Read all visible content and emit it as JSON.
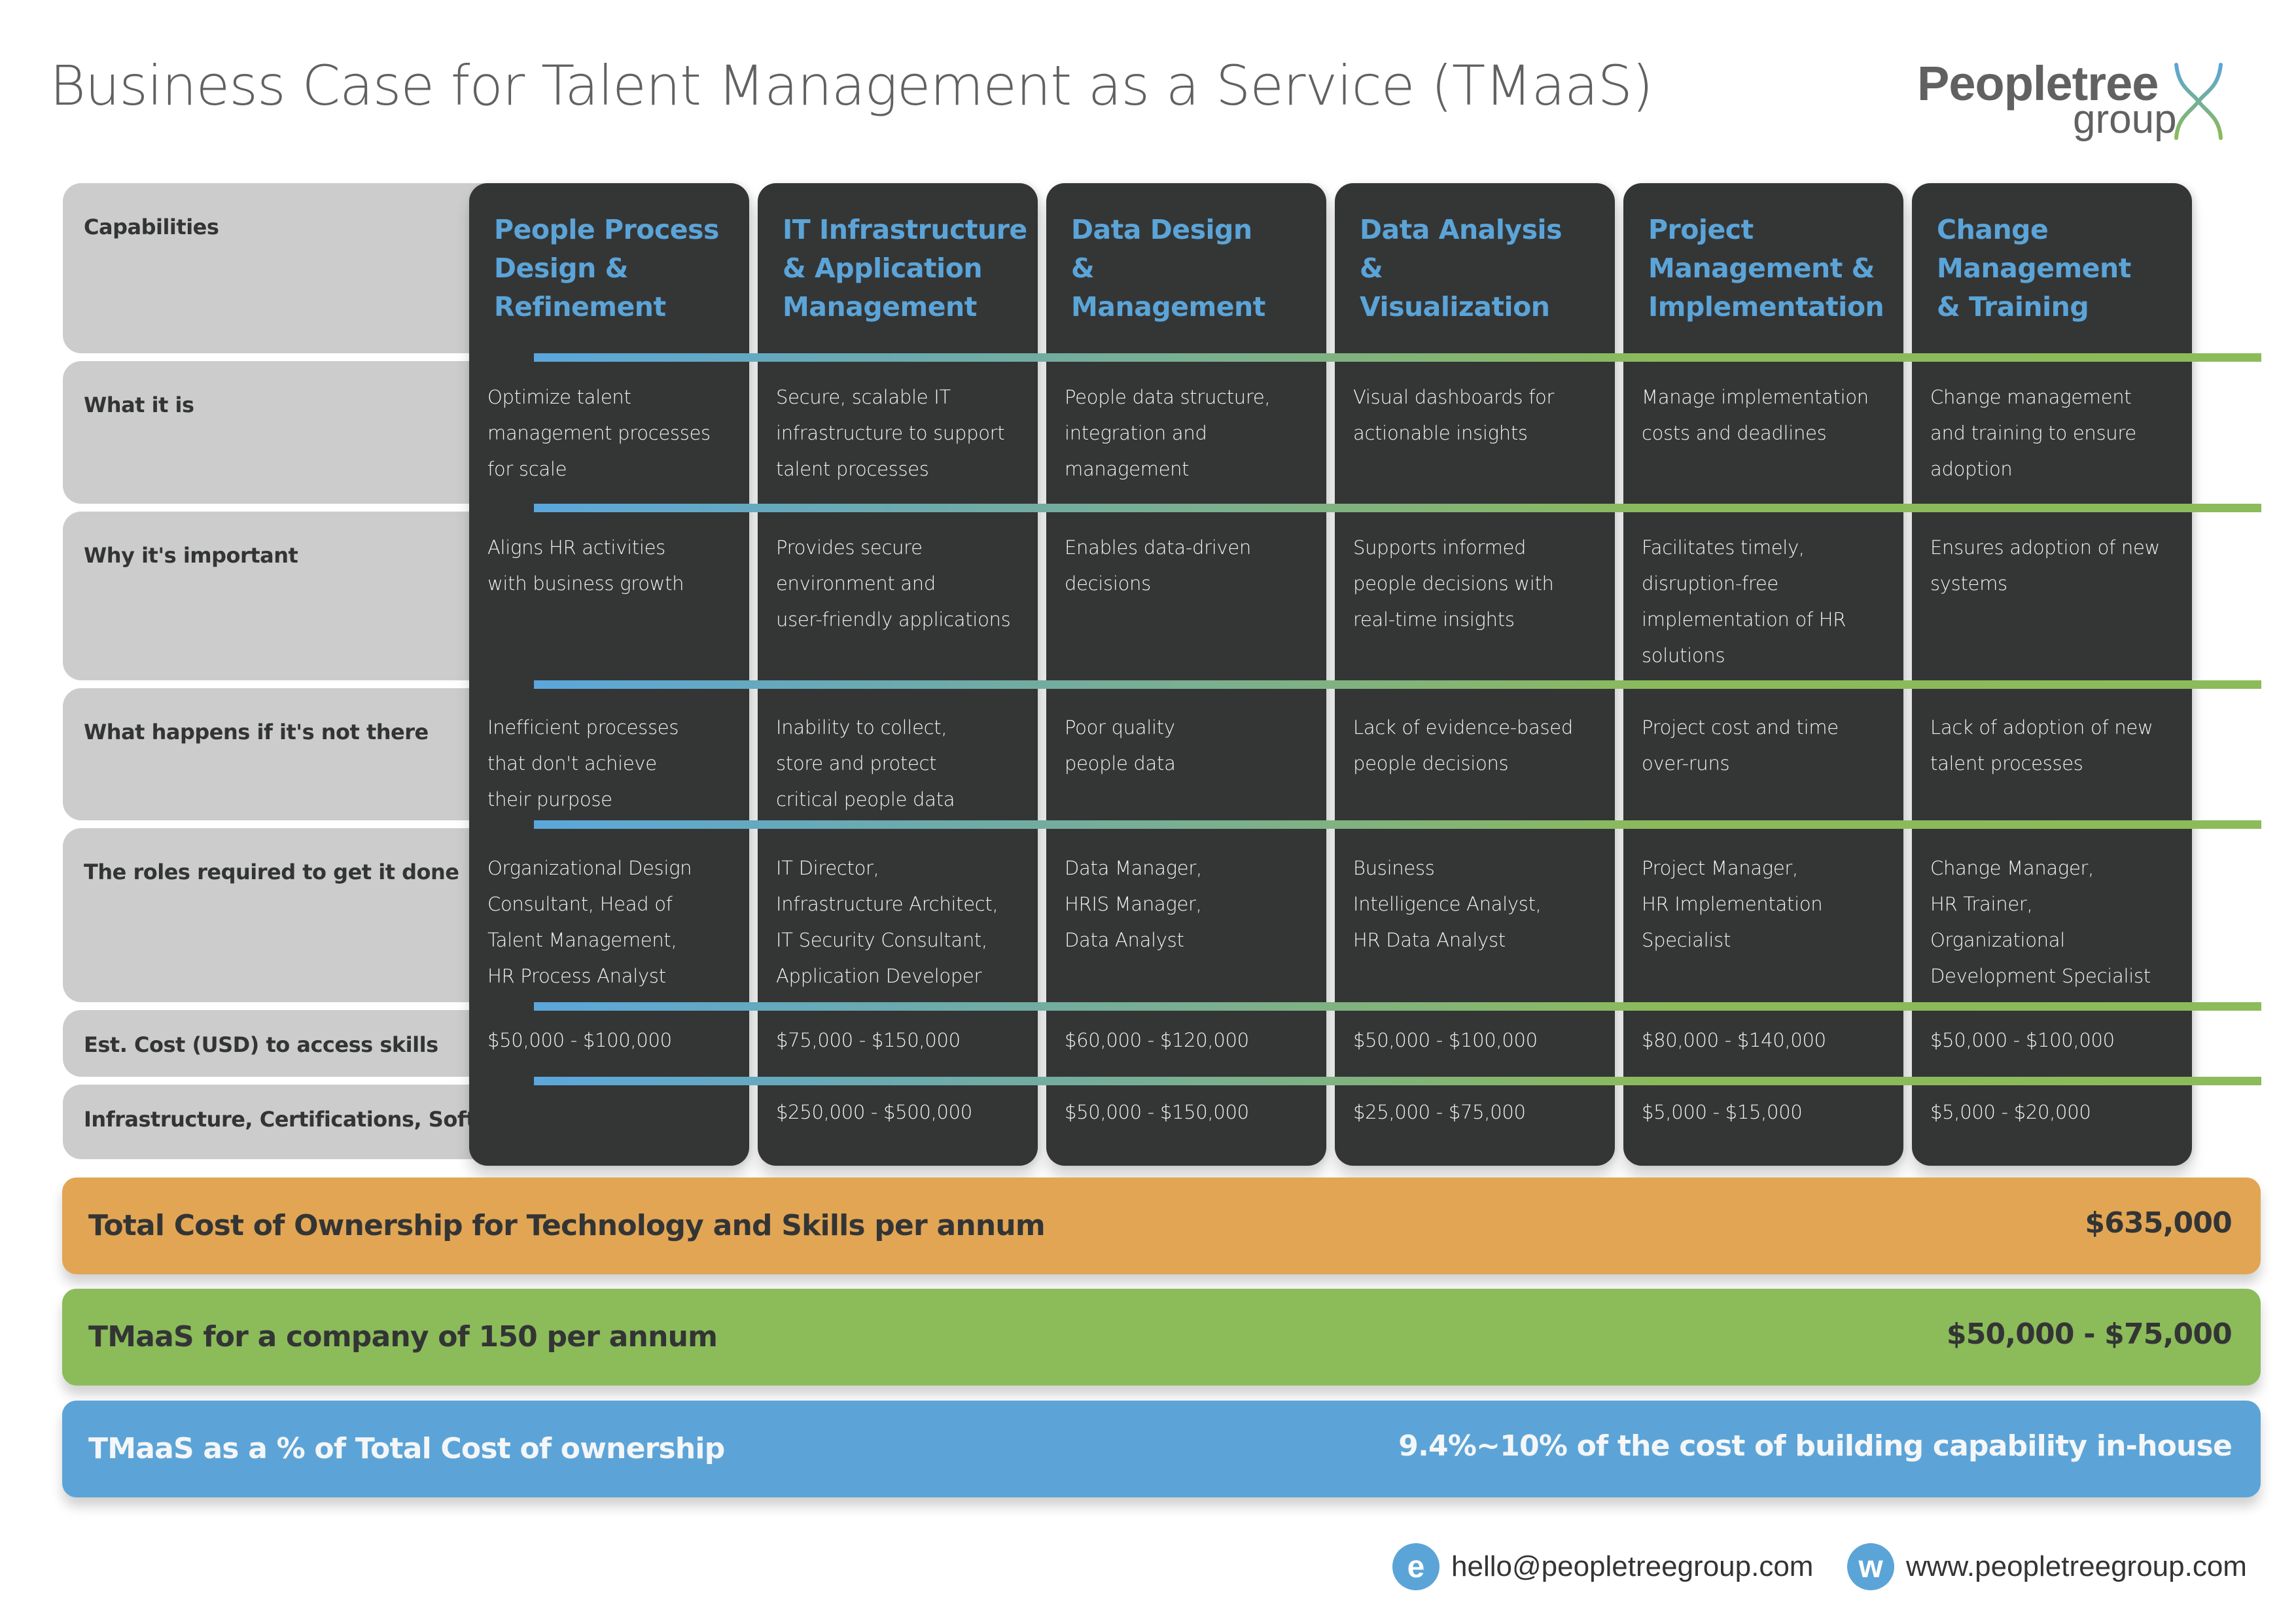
{
  "header": {
    "title": "Business Case for Talent Management as a Service (TMaaS)",
    "logo": {
      "name": "Peopletree",
      "group": "group"
    }
  },
  "colors": {
    "accent_blue": "#5ba4d8",
    "accent_green": "#8cbb5a",
    "orange": "#e2a554",
    "dark_panel": "#343636",
    "label_bg": "#cccccc"
  },
  "row_labels": [
    "Capabilities",
    "What it is",
    "Why it's important",
    "What happens if it's not there",
    "The roles required to get it done",
    "Est. Cost (USD) to access skills",
    "Infrastructure, Certifications, Software"
  ],
  "columns": [
    {
      "title": [
        "People Process",
        "Design &",
        "Refinement"
      ],
      "what": [
        "Optimize talent",
        "management processes",
        "for scale"
      ],
      "why": [
        "Aligns HR activities",
        "with business growth"
      ],
      "missing": [
        "Inefficient processes",
        "that don't achieve",
        "their purpose"
      ],
      "roles": [
        "Organizational Design",
        "Consultant, Head of",
        "Talent Management,",
        "HR Process Analyst"
      ],
      "cost": "$50,000 - $100,000",
      "infra": ""
    },
    {
      "title": [
        "IT Infrastructure",
        "& Application",
        "Management"
      ],
      "what": [
        "Secure, scalable IT",
        "infrastructure to support",
        "talent processes"
      ],
      "why": [
        "Provides secure",
        "environment and",
        "user-friendly applications"
      ],
      "missing": [
        "Inability to collect,",
        "store and protect",
        "critical people data"
      ],
      "roles": [
        "IT Director,",
        "Infrastructure Architect,",
        "IT Security Consultant,",
        "Application Developer"
      ],
      "cost": "$75,000 - $150,000",
      "infra": "$250,000 - $500,000"
    },
    {
      "title": [
        "Data Design",
        "&",
        "Management"
      ],
      "what": [
        "People data structure,",
        "integration and",
        "management"
      ],
      "why": [
        "Enables data-driven",
        "decisions"
      ],
      "missing": [
        "Poor quality",
        "people data"
      ],
      "roles": [
        "Data Manager,",
        "HRIS Manager,",
        "Data Analyst"
      ],
      "cost": "$60,000 - $120,000",
      "infra": "$50,000 - $150,000"
    },
    {
      "title": [
        "Data Analysis",
        "&",
        "Visualization"
      ],
      "what": [
        "Visual dashboards for",
        "actionable insights"
      ],
      "why": [
        "Supports informed",
        "people decisions with",
        "real-time insights"
      ],
      "missing": [
        "Lack of evidence-based",
        "people decisions"
      ],
      "roles": [
        "Business",
        "Intelligence Analyst,",
        "HR Data Analyst"
      ],
      "cost": "$50,000 - $100,000",
      "infra": "$25,000 - $75,000"
    },
    {
      "title": [
        "Project",
        "Management &",
        "Implementation"
      ],
      "what": [
        "Manage implementation",
        "costs and deadlines"
      ],
      "why": [
        "Facilitates timely,",
        "disruption-free",
        "implementation of HR",
        "solutions"
      ],
      "missing": [
        "Project cost and time",
        "over-runs"
      ],
      "roles": [
        "Project Manager,",
        "HR Implementation",
        "Specialist"
      ],
      "cost": "$80,000 - $140,000",
      "infra": "$5,000 - $15,000"
    },
    {
      "title": [
        "Change",
        "Management",
        "& Training"
      ],
      "what": [
        "Change management",
        "and training to ensure",
        "adoption"
      ],
      "why": [
        "Ensures adoption of new",
        "systems"
      ],
      "missing": [
        "Lack of adoption of new",
        "talent processes"
      ],
      "roles": [
        "Change Manager,",
        "HR Trainer,",
        "Organizational",
        "Development Specialist"
      ],
      "cost": "$50,000 - $100,000",
      "infra": "$5,000 - $20,000"
    }
  ],
  "summary": {
    "tco": {
      "label": "Total Cost of Ownership for  Technology and Skills per annum",
      "value": "$635,000"
    },
    "tmaas": {
      "label": "TMaaS for a company of 150 per annum",
      "value": "$50,000 - $75,000"
    },
    "percent": {
      "label": "TMaaS as a % of Total Cost of ownership",
      "value": "9.4%~10% of the cost of building capability in-house"
    }
  },
  "footer": {
    "email_icon": "e",
    "email": "hello@peopletreegroup.com",
    "web_icon": "w",
    "website": "www.peopletreegroup.com"
  }
}
